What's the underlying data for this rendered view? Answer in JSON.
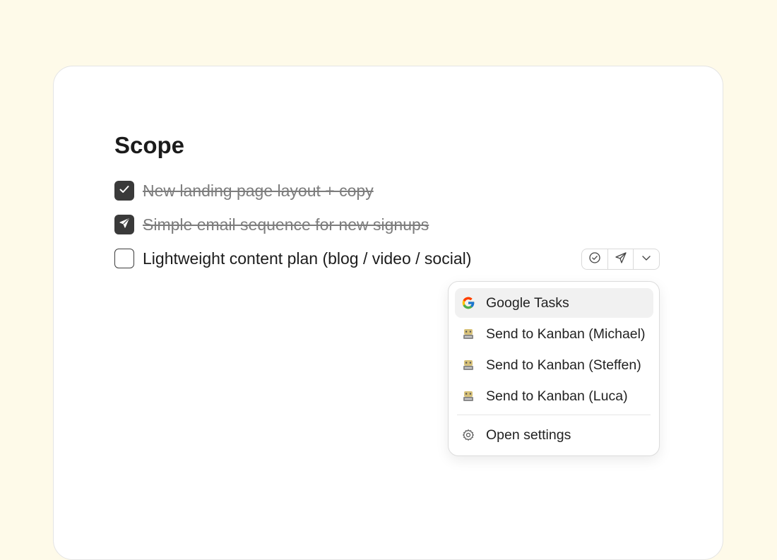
{
  "section": {
    "title": "Scope"
  },
  "tasks": [
    {
      "text": "New landing page layout + copy",
      "status": "done",
      "icon": "check-icon"
    },
    {
      "text": "Simple email sequence for new signups",
      "status": "sent",
      "icon": "send-icon"
    },
    {
      "text": "Lightweight content plan (blog / video / social)",
      "status": "open",
      "icon": ""
    }
  ],
  "toolbar": {
    "buttons": [
      "complete-icon",
      "send-icon",
      "chevron-down-icon"
    ]
  },
  "menu": {
    "items": [
      {
        "label": "Google Tasks",
        "icon": "google-icon",
        "active": true
      },
      {
        "label": "Send to Kanban (Michael)",
        "icon": "kanban-robot-icon"
      },
      {
        "label": "Send to Kanban (Steffen)",
        "icon": "kanban-robot-icon"
      },
      {
        "label": "Send to Kanban (Luca)",
        "icon": "kanban-robot-icon"
      }
    ],
    "settings_label": "Open settings",
    "settings_icon": "gear-icon"
  },
  "colors": {
    "page_bg": "#fefae9",
    "card_bg": "#ffffff",
    "checkbox_fill": "#3a3a3a",
    "done_text": "#7c7c7c",
    "menu_active_bg": "#f1f1f1"
  }
}
